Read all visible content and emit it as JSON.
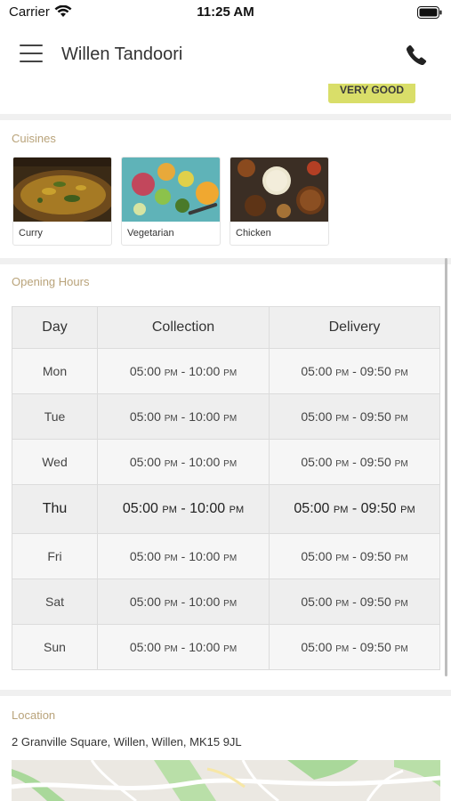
{
  "status_bar": {
    "carrier": "Carrier",
    "time": "11:25 AM",
    "icons": [
      "wifi-icon",
      "battery-icon"
    ]
  },
  "header": {
    "title": "Willen Tandoori",
    "menu_icon": "menu-icon",
    "phone_icon": "phone-icon"
  },
  "rating": {
    "label": "VERY GOOD",
    "color": "#d9de69"
  },
  "cuisines": {
    "title": "Cuisines",
    "items": [
      {
        "label": "Curry"
      },
      {
        "label": "Vegetarian"
      },
      {
        "label": "Chicken"
      }
    ]
  },
  "opening_hours": {
    "title": "Opening Hours",
    "headers": [
      "Day",
      "Collection",
      "Delivery"
    ],
    "rows": [
      {
        "day": "Mon",
        "col_start": "05:00",
        "col_start_ampm": "PM",
        "col_end": "10:00",
        "col_end_ampm": "PM",
        "del_start": "05:00",
        "del_start_ampm": "PM",
        "del_end": "09:50",
        "del_end_ampm": "PM"
      },
      {
        "day": "Tue",
        "col_start": "05:00",
        "col_start_ampm": "PM",
        "col_end": "10:00",
        "col_end_ampm": "PM",
        "del_start": "05:00",
        "del_start_ampm": "PM",
        "del_end": "09:50",
        "del_end_ampm": "PM"
      },
      {
        "day": "Wed",
        "col_start": "05:00",
        "col_start_ampm": "PM",
        "col_end": "10:00",
        "col_end_ampm": "PM",
        "del_start": "05:00",
        "del_start_ampm": "PM",
        "del_end": "09:50",
        "del_end_ampm": "PM"
      },
      {
        "day": "Thu",
        "col_start": "05:00",
        "col_start_ampm": "PM",
        "col_end": "10:00",
        "col_end_ampm": "PM",
        "del_start": "05:00",
        "del_start_ampm": "PM",
        "del_end": "09:50",
        "del_end_ampm": "PM"
      },
      {
        "day": "Fri",
        "col_start": "05:00",
        "col_start_ampm": "PM",
        "col_end": "10:00",
        "col_end_ampm": "PM",
        "del_start": "05:00",
        "del_start_ampm": "PM",
        "del_end": "09:50",
        "del_end_ampm": "PM"
      },
      {
        "day": "Sat",
        "col_start": "05:00",
        "col_start_ampm": "PM",
        "col_end": "10:00",
        "col_end_ampm": "PM",
        "del_start": "05:00",
        "del_start_ampm": "PM",
        "del_end": "09:50",
        "del_end_ampm": "PM"
      },
      {
        "day": "Sun",
        "col_start": "05:00",
        "col_start_ampm": "PM",
        "col_end": "10:00",
        "col_end_ampm": "PM",
        "del_start": "05:00",
        "del_start_ampm": "PM",
        "del_end": "09:50",
        "del_end_ampm": "PM"
      }
    ],
    "highlighted_day": "Thu"
  },
  "location": {
    "title": "Location",
    "address": "2 Granville Square, Willen, Willen, MK15 9JL"
  },
  "colors": {
    "section_title": "#b9a37a",
    "divider": "#f0f0f0"
  }
}
